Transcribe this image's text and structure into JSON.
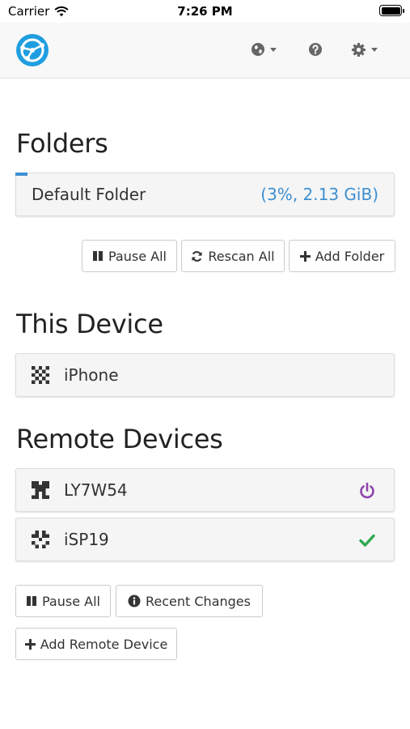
{
  "status_bar": {
    "carrier": "Carrier",
    "time": "7:26 PM"
  },
  "navbar": {
    "icons": [
      "syncthing-logo",
      "globe-icon",
      "help-icon",
      "gear-icon"
    ]
  },
  "folders": {
    "heading": "Folders",
    "items": [
      {
        "label": "Default Folder",
        "status": "(3%, 2.13 GiB)",
        "progress_percent": 3
      }
    ],
    "buttons": {
      "pause_all": "Pause All",
      "rescan_all": "Rescan All",
      "add_folder": "Add Folder"
    }
  },
  "this_device": {
    "heading": "This Device",
    "name": "iPhone"
  },
  "remote_devices": {
    "heading": "Remote Devices",
    "items": [
      {
        "name": "LY7W54",
        "status_icon": "power-icon",
        "status_color": "#8e44ad"
      },
      {
        "name": "iSP19",
        "status_icon": "check-icon",
        "status_color": "#2fa84f"
      }
    ],
    "buttons": {
      "pause_all": "Pause All",
      "recent_changes": "Recent Changes",
      "add_remote_device": "Add Remote Device"
    }
  },
  "colors": {
    "accent": "#3d8fd1",
    "navbar_bg": "#f8f8f8",
    "panel_bg": "#f5f5f5"
  }
}
